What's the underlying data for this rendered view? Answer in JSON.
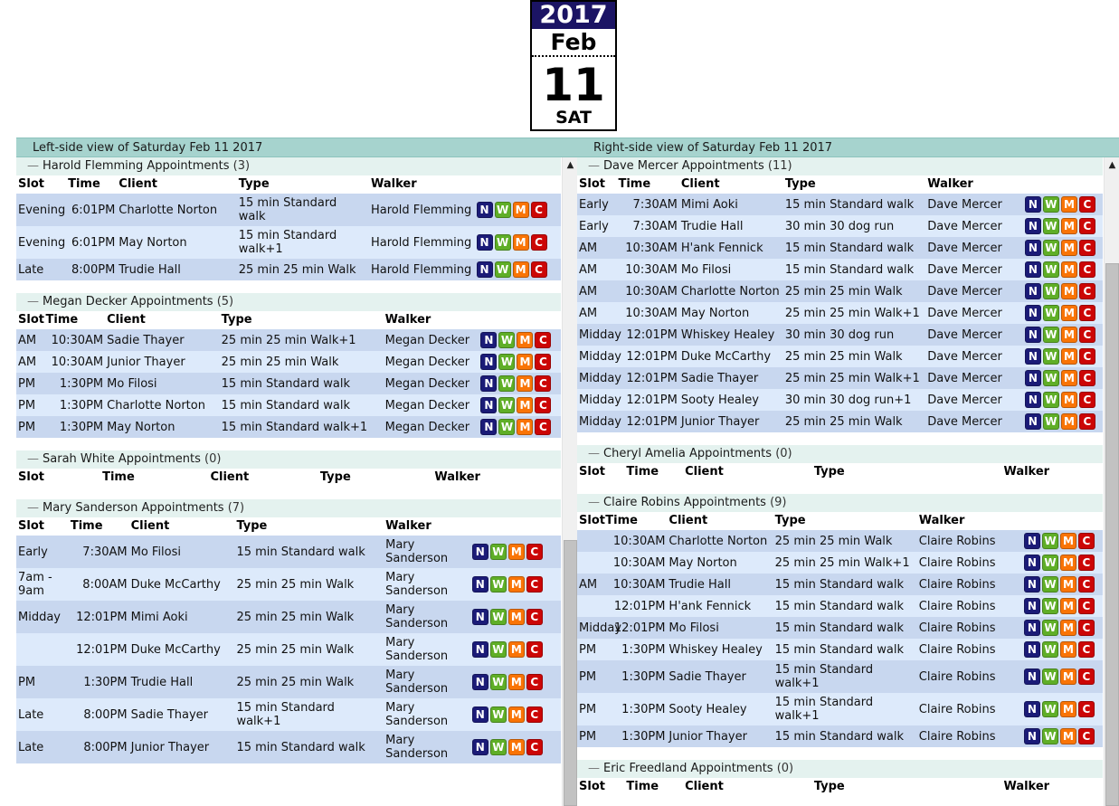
{
  "date_block": {
    "year": "2017",
    "month": "Feb",
    "day": "11",
    "weekday": "Sat"
  },
  "panels": {
    "left": {
      "title": "Left-side view of Saturday Feb 11 2017",
      "columns": [
        "Slot",
        "Time",
        "Client",
        "Type",
        "Walker"
      ],
      "groups": [
        {
          "name": "Harold Flemming",
          "label": "Harold Flemming Appointments",
          "count": "(3)",
          "collapse_icon": "—",
          "widths": "cw-a",
          "rows": [
            {
              "slot": "Evening",
              "time": "6:01PM",
              "client": "Charlotte Norton",
              "type": "15 min Standard walk",
              "walker": "Harold Flemming"
            },
            {
              "slot": "Evening",
              "time": "6:01PM",
              "client": "May Norton",
              "type": "15 min Standard walk+1",
              "walker": "Harold Flemming"
            },
            {
              "slot": "Late",
              "time": "8:00PM",
              "client": "Trudie Hall",
              "type": "25 min 25 min Walk",
              "walker": "Harold Flemming"
            }
          ]
        },
        {
          "name": "Megan Decker",
          "label": "Megan Decker Appointments",
          "count": "(5)",
          "collapse_icon": "—",
          "widths": "cw-b",
          "rows": [
            {
              "slot": "AM",
              "time": "10:30AM",
              "client": "Sadie Thayer",
              "type": "25 min 25 min Walk+1",
              "walker": "Megan Decker"
            },
            {
              "slot": "AM",
              "time": "10:30AM",
              "client": "Junior Thayer",
              "type": "25 min 25 min Walk",
              "walker": "Megan Decker"
            },
            {
              "slot": "PM",
              "time": "1:30PM",
              "client": "Mo Filosi",
              "type": "15 min Standard walk",
              "walker": "Megan Decker"
            },
            {
              "slot": "PM",
              "time": "1:30PM",
              "client": "Charlotte Norton",
              "type": "15 min Standard walk",
              "walker": "Megan Decker"
            },
            {
              "slot": "PM",
              "time": "1:30PM",
              "client": "May Norton",
              "type": "15 min Standard walk+1",
              "walker": "Megan Decker"
            }
          ]
        },
        {
          "name": "Sarah White",
          "label": "Sarah White Appointments",
          "count": "(0)",
          "collapse_icon": "—",
          "widths": "cw-e",
          "rows": []
        },
        {
          "name": "Mary Sanderson",
          "label": "Mary Sanderson Appointments",
          "count": "(7)",
          "collapse_icon": "—",
          "widths": "cw-c",
          "rows": [
            {
              "slot": "Early",
              "time": "7:30AM",
              "client": "Mo Filosi",
              "type": "15 min Standard walk",
              "walker": "Mary Sanderson"
            },
            {
              "slot": "7am - 9am",
              "time": "8:00AM",
              "client": "Duke McCarthy",
              "type": "25 min 25 min Walk",
              "walker": "Mary Sanderson"
            },
            {
              "slot": "Midday",
              "time": "12:01PM",
              "client": "Mimi Aoki",
              "type": "25 min 25 min Walk",
              "walker": "Mary Sanderson"
            },
            {
              "slot": "",
              "time": "12:01PM",
              "client": "Duke McCarthy",
              "type": "25 min 25 min Walk",
              "walker": "Mary Sanderson"
            },
            {
              "slot": "PM",
              "time": "1:30PM",
              "client": "Trudie Hall",
              "type": "25 min 25 min Walk",
              "walker": "Mary Sanderson"
            },
            {
              "slot": "Late",
              "time": "8:00PM",
              "client": "Sadie Thayer",
              "type": "15 min Standard walk+1",
              "walker": "Mary Sanderson"
            },
            {
              "slot": "Late",
              "time": "8:00PM",
              "client": "Junior Thayer",
              "type": "15 min Standard walk",
              "walker": "Mary Sanderson"
            }
          ]
        }
      ]
    },
    "right": {
      "title": "Right-side view of Saturday Feb 11 2017",
      "columns": [
        "Slot",
        "Time",
        "Client",
        "Type",
        "Walker"
      ],
      "groups": [
        {
          "name": "Dave Mercer",
          "label": "Dave Mercer Appointments",
          "count": "(11)",
          "collapse_icon": "—",
          "widths": "cw-r1",
          "rows": [
            {
              "slot": "Early",
              "time": "7:30AM",
              "client": "Mimi Aoki",
              "type": "15 min Standard walk",
              "walker": "Dave Mercer"
            },
            {
              "slot": "Early",
              "time": "7:30AM",
              "client": "Trudie Hall",
              "type": "30 min 30 dog run",
              "walker": "Dave Mercer"
            },
            {
              "slot": "AM",
              "time": "10:30AM",
              "client": "H'ank Fennick",
              "type": "15 min Standard walk",
              "walker": "Dave Mercer"
            },
            {
              "slot": "AM",
              "time": "10:30AM",
              "client": "Mo Filosi",
              "type": "15 min Standard walk",
              "walker": "Dave Mercer"
            },
            {
              "slot": "AM",
              "time": "10:30AM",
              "client": "Charlotte Norton",
              "type": "25 min 25 min Walk",
              "walker": "Dave Mercer"
            },
            {
              "slot": "AM",
              "time": "10:30AM",
              "client": "May Norton",
              "type": "25 min 25 min Walk+1",
              "walker": "Dave Mercer"
            },
            {
              "slot": "Midday",
              "time": "12:01PM",
              "client": "Whiskey Healey",
              "type": "30 min 30 dog run",
              "walker": "Dave Mercer"
            },
            {
              "slot": "Midday",
              "time": "12:01PM",
              "client": "Duke McCarthy",
              "type": "25 min 25 min Walk",
              "walker": "Dave Mercer"
            },
            {
              "slot": "Midday",
              "time": "12:01PM",
              "client": "Sadie Thayer",
              "type": "25 min 25 min Walk+1",
              "walker": "Dave Mercer"
            },
            {
              "slot": "Midday",
              "time": "12:01PM",
              "client": "Sooty Healey",
              "type": "30 min 30 dog run+1",
              "walker": "Dave Mercer"
            },
            {
              "slot": "Midday",
              "time": "12:01PM",
              "client": "Junior Thayer",
              "type": "25 min 25 min Walk",
              "walker": "Dave Mercer"
            }
          ]
        },
        {
          "name": "Cheryl Amelia",
          "label": "Cheryl Amelia Appointments",
          "count": "(0)",
          "collapse_icon": "—",
          "widths": "cw-r2",
          "rows": []
        },
        {
          "name": "Claire Robins",
          "label": "Claire Robins Appointments",
          "count": "(9)",
          "collapse_icon": "—",
          "widths": "cw-r3",
          "rows": [
            {
              "slot": "",
              "time": "10:30AM",
              "client": "Charlotte Norton",
              "type": "25 min 25 min Walk",
              "walker": "Claire Robins"
            },
            {
              "slot": "",
              "time": "10:30AM",
              "client": "May Norton",
              "type": "25 min 25 min Walk+1",
              "walker": "Claire Robins"
            },
            {
              "slot": "AM",
              "time": "10:30AM",
              "client": "Trudie Hall",
              "type": "15 min Standard walk",
              "walker": "Claire Robins"
            },
            {
              "slot": "",
              "time": "12:01PM",
              "client": "H'ank Fennick",
              "type": "15 min Standard walk",
              "walker": "Claire Robins"
            },
            {
              "slot": "Midday",
              "time": "12:01PM",
              "client": "Mo Filosi",
              "type": "15 min Standard walk",
              "walker": "Claire Robins"
            },
            {
              "slot": "PM",
              "time": "1:30PM",
              "client": "Whiskey Healey",
              "type": "15 min Standard walk",
              "walker": "Claire Robins"
            },
            {
              "slot": "PM",
              "time": "1:30PM",
              "client": "Sadie Thayer",
              "type": "15 min Standard walk+1",
              "walker": "Claire Robins"
            },
            {
              "slot": "PM",
              "time": "1:30PM",
              "client": "Sooty Healey",
              "type": "15 min Standard walk+1",
              "walker": "Claire Robins"
            },
            {
              "slot": "PM",
              "time": "1:30PM",
              "client": "Junior Thayer",
              "type": "15 min Standard walk",
              "walker": "Claire Robins"
            }
          ]
        },
        {
          "name": "Eric Freedland",
          "label": "Eric Freedland Appointments",
          "count": "(0)",
          "collapse_icon": "—",
          "widths": "cw-r2",
          "rows": []
        }
      ]
    }
  },
  "row_actions": [
    {
      "key": "N",
      "label": "N",
      "name": "note-button",
      "color": "#1b1b77"
    },
    {
      "key": "W",
      "label": "W",
      "name": "walk-button",
      "color": "#5fae27"
    },
    {
      "key": "M",
      "label": "M",
      "name": "map-button",
      "color": "#f97406"
    },
    {
      "key": "C",
      "label": "C",
      "name": "cancel-button",
      "color": "#cc0606"
    }
  ],
  "scrollbars": {
    "up_arrow_glyph": "▲"
  }
}
